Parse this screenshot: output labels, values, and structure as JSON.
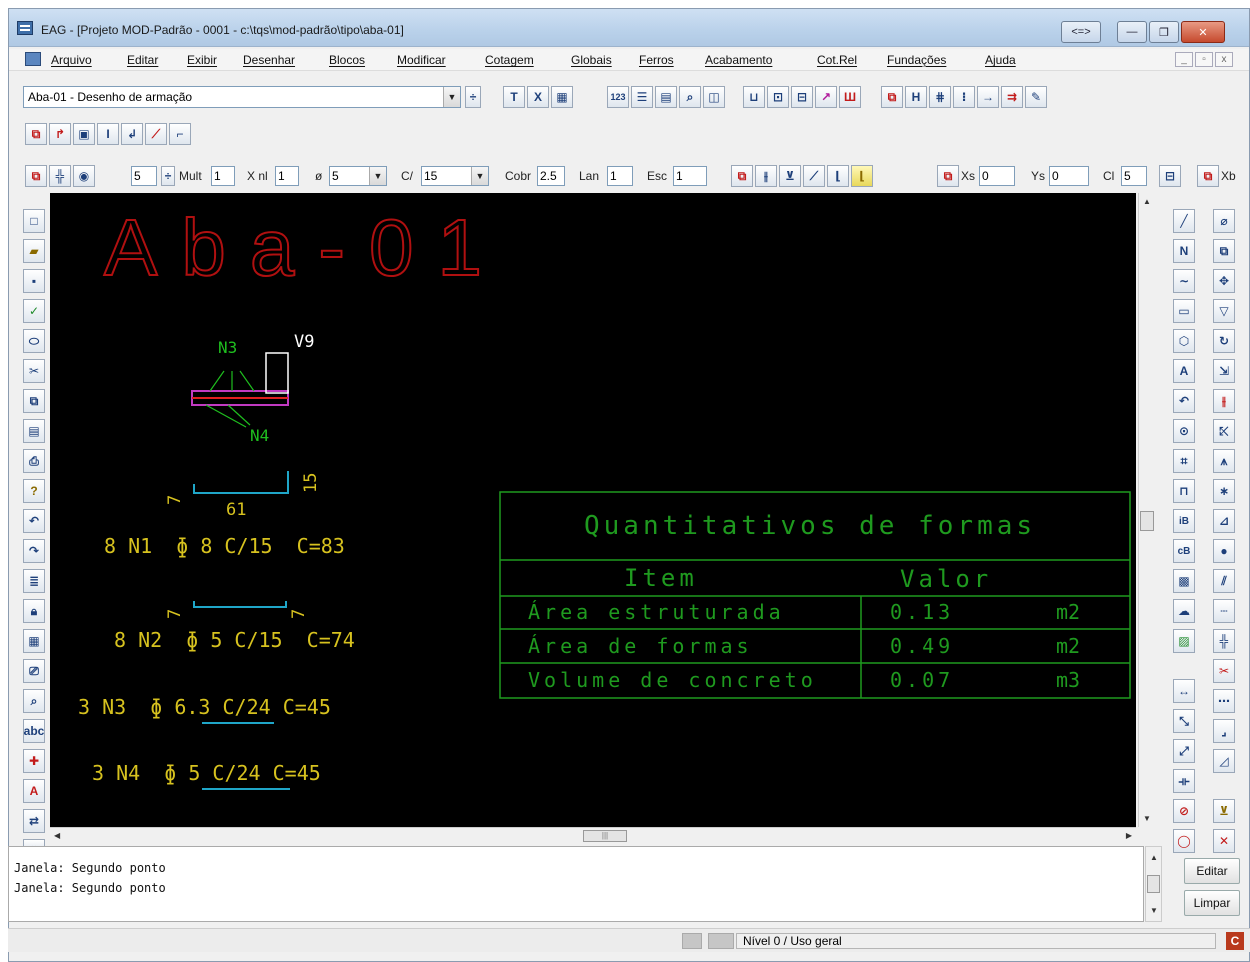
{
  "window": {
    "title": "EAG - [Projeto MOD-Padrão - 0001 - c:\\tqs\\mod-padrão\\tipo\\aba-01]",
    "title_help": "<=>",
    "minimize": "—",
    "restore": "❐",
    "close": "✕"
  },
  "menu": {
    "items": [
      "Arquivo",
      "Editar",
      "Exibir",
      "Desenhar",
      "Blocos",
      "Modificar",
      "Cotagem",
      "Globais",
      "Ferros",
      "Acabamento",
      "Cot.Rel",
      "Fundações",
      "Ajuda"
    ],
    "mdi_minimize": "_",
    "mdi_restore": "▫",
    "mdi_close": "x"
  },
  "toolbar1": {
    "drawing_select": "Aba-01 - Desenho de armação"
  },
  "toolbar3": {
    "bar_value": "5",
    "mult_label": "Mult",
    "mult_value": "1",
    "xnl_label": "X nl",
    "xnl_value": "1",
    "diam_label": "ø",
    "diam_value": "5",
    "c_label": "C/",
    "c_value": "15",
    "cobr_label": "Cobr",
    "cobr_value": "2.5",
    "lan_label": "Lan",
    "lan_value": "1",
    "esc_label": "Esc",
    "esc_value": "1",
    "xs_label": "Xs",
    "xs_value": "0",
    "ys_label": "Ys",
    "ys_value": "0",
    "cl_label": "Cl",
    "cl_value": "5",
    "xb_label": "Xb"
  },
  "drawing": {
    "title": "Aba-01",
    "section_label_n3": "N3",
    "section_label_v9": "V9",
    "section_label_n4": "N4",
    "bar1_dim_left": "7",
    "bar1_dim_length": "61",
    "bar1_dim_right": "15",
    "bar1_spec": "8 N1  ɸ 8 C/15  C=83",
    "bar2_dim_left": "7",
    "bar2_dim_right": "7",
    "bar2_spec": "8 N2  ɸ 5 C/15  C=74",
    "bar3_spec_prefix": "3 N3  ɸ ",
    "bar3_spec_under": "6.3 C/24",
    "bar3_spec_suffix": " C=45",
    "bar4_spec_prefix": "3 N4  ɸ ",
    "bar4_spec_under": "5 C/24",
    "bar4_spec_suffix": " C=45",
    "colors": {
      "title": "#b01010",
      "green": "#1fbf1f",
      "yellow": "#d7c21f",
      "white": "#ffffff",
      "cyan": "#1fa6c8",
      "magenta": "#c23ac2",
      "red": "#e02020",
      "frame": "#1f9a1f"
    }
  },
  "table": {
    "title": "Quantitativos de formas",
    "header_item": "Item",
    "header_value": "Valor",
    "rows": [
      {
        "item": "Área estruturada",
        "value": "0.13",
        "unit": "m2"
      },
      {
        "item": "Área de formas",
        "value": "0.49",
        "unit": "m2"
      },
      {
        "item": "Volume de concreto",
        "value": "0.07",
        "unit": "m3"
      }
    ]
  },
  "command": {
    "lines": [
      "Janela: Segundo ponto",
      "Janela: Segundo ponto"
    ],
    "edit_button": "Editar",
    "clear_button": "Limpar"
  },
  "status": {
    "level": "Nível 0 / Uso geral",
    "logo": "C"
  },
  "scroll": {
    "h_thumb": "|||"
  }
}
